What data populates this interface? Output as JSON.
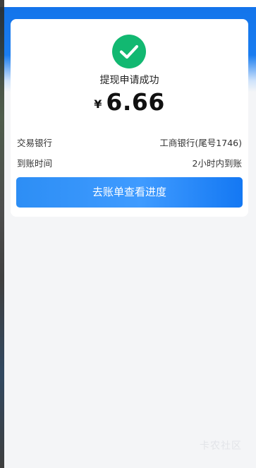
{
  "result": {
    "status_text": "提现申请成功",
    "currency_symbol": "¥",
    "amount": "6.66"
  },
  "details": {
    "bank_label": "交易银行",
    "bank_value": "工商银行(尾号1746)",
    "time_label": "到账时间",
    "time_value": "2小时内到账"
  },
  "action": {
    "button_label": "去账单查看进度"
  },
  "watermark": {
    "text": "卡农社区"
  },
  "colors": {
    "primary_blue": "#1a7df0",
    "success_green": "#12b871",
    "page_background": "#f4f5f7"
  },
  "icons": {
    "status_icon": "check-circle-icon"
  }
}
